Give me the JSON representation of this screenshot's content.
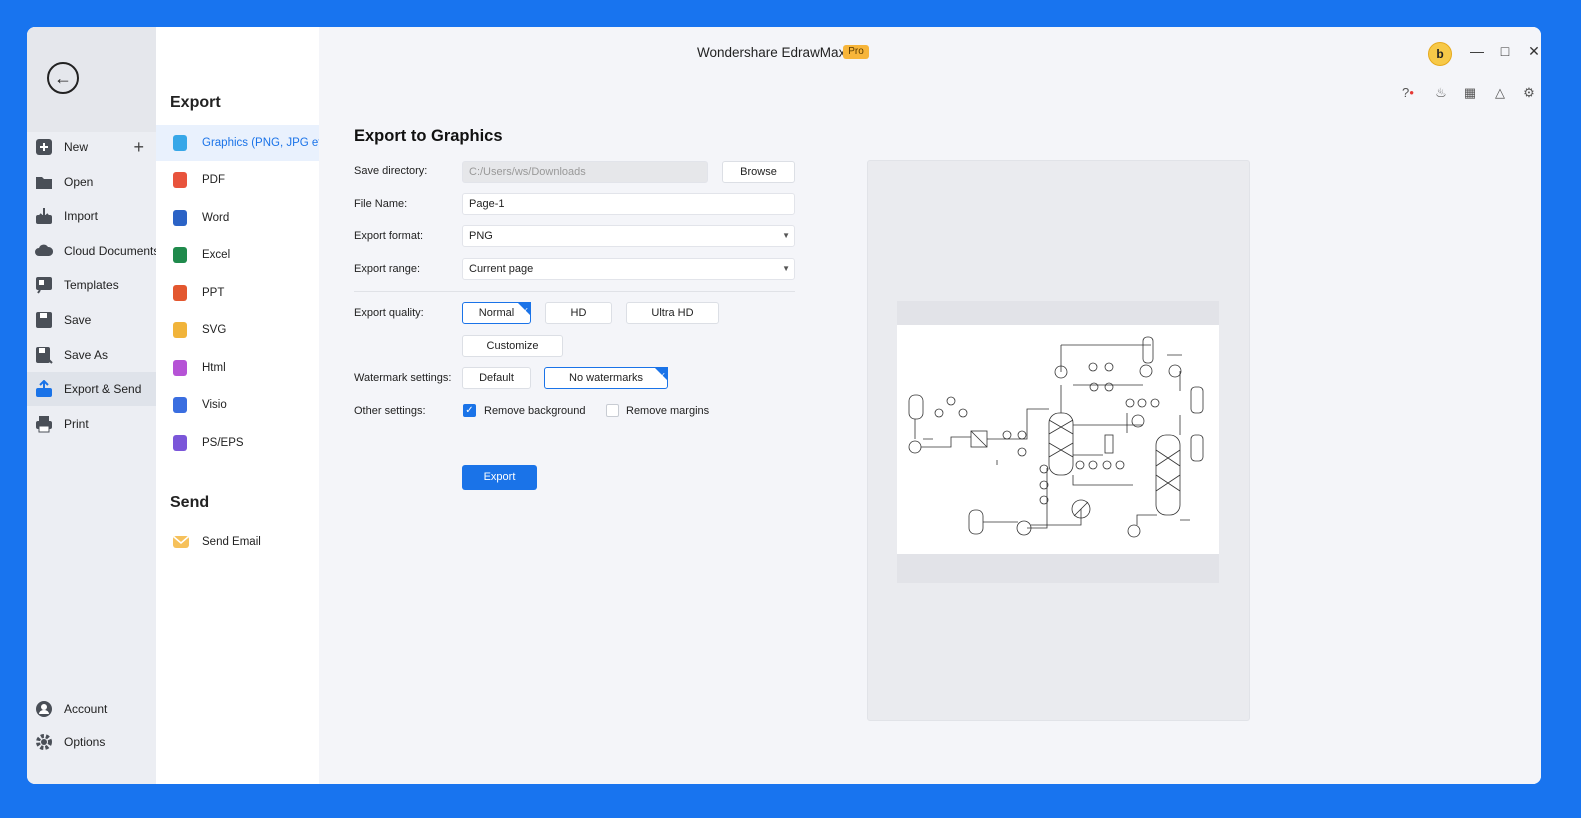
{
  "app": {
    "title": "Wondershare EdrawMax",
    "badge": "Pro",
    "avatar_letter": "b"
  },
  "window_controls": [
    "minimize-icon",
    "maximize-icon",
    "close-icon"
  ],
  "toolbar_icons": [
    "help-icon",
    "bell-icon",
    "apps-icon",
    "shirt-icon",
    "gear-icon"
  ],
  "leftnav": {
    "items": [
      {
        "label": "New",
        "icon": "new-icon"
      },
      {
        "label": "Open",
        "icon": "folder-icon"
      },
      {
        "label": "Import",
        "icon": "import-icon"
      },
      {
        "label": "Cloud Documents",
        "icon": "cloud-icon"
      },
      {
        "label": "Templates",
        "icon": "templates-icon"
      },
      {
        "label": "Save",
        "icon": "save-icon"
      },
      {
        "label": "Save As",
        "icon": "save-as-icon"
      },
      {
        "label": "Export & Send",
        "icon": "export-icon"
      },
      {
        "label": "Print",
        "icon": "print-icon"
      }
    ],
    "bottom": [
      {
        "label": "Account",
        "icon": "account-icon"
      },
      {
        "label": "Options",
        "icon": "gear-icon"
      }
    ]
  },
  "export_section": {
    "title": "Export",
    "formats": [
      {
        "label": "Graphics (PNG, JPG et...",
        "color": "#37a7e8"
      },
      {
        "label": "PDF",
        "color": "#e8533c"
      },
      {
        "label": "Word",
        "color": "#2b63c6"
      },
      {
        "label": "Excel",
        "color": "#1f8a4c"
      },
      {
        "label": "PPT",
        "color": "#e3572f"
      },
      {
        "label": "SVG",
        "color": "#f1b43a"
      },
      {
        "label": "Html",
        "color": "#b653d6"
      },
      {
        "label": "Visio",
        "color": "#3a6ee0"
      },
      {
        "label": "PS/EPS",
        "color": "#7b56d9"
      }
    ]
  },
  "send_section": {
    "title": "Send",
    "items": [
      {
        "label": "Send Email"
      }
    ]
  },
  "form": {
    "heading": "Export to Graphics",
    "save_directory_label": "Save directory:",
    "save_directory_value": "C:/Users/ws/Downloads",
    "browse_label": "Browse",
    "file_name_label": "File Name:",
    "file_name_value": "Page-1",
    "export_format_label": "Export format:",
    "export_format_value": "PNG",
    "export_range_label": "Export range:",
    "export_range_value": "Current page",
    "quality_label": "Export quality:",
    "quality_options": [
      "Normal",
      "HD",
      "Ultra HD",
      "Customize"
    ],
    "watermark_label": "Watermark settings:",
    "watermark_options": [
      "Default",
      "No watermarks"
    ],
    "other_label": "Other settings:",
    "remove_background_label": "Remove background",
    "remove_margins_label": "Remove margins",
    "export_button": "Export"
  },
  "colors": {
    "accent": "#1a73e8",
    "frame": "#1874ef",
    "pro_badge": "#f7b53a"
  }
}
